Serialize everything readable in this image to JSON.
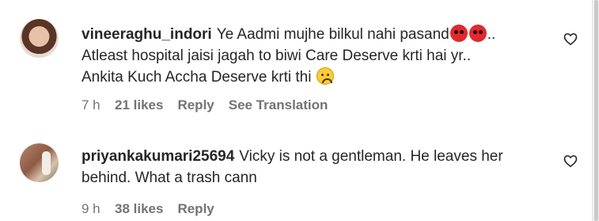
{
  "comments": [
    {
      "username": "vineeraghu_indori",
      "text_1": "Ye Aadmi mujhe bilkul nahi pasand",
      "text_2": "..",
      "text_3": "Atleast hospital jaisi jagah to biwi Care Deserve krti hai yr..",
      "text_4": "Ankita Kuch Accha Deserve krti thi",
      "time": "7 h",
      "likes": "21 likes",
      "reply": "Reply",
      "translate": "See Translation",
      "emojis": [
        "angry-face",
        "angry-face",
        "sad-face"
      ]
    },
    {
      "username": "priyankakumari25694",
      "text_1": "Vicky is not a gentleman. He leaves her",
      "text_2": "behind. What a trash cann",
      "time": "9 h",
      "likes": "38 likes",
      "reply": "Reply"
    }
  ],
  "colors": {
    "text": "#262626",
    "meta": "#737373",
    "angry_emoji": "#e0292c",
    "sad_emoji": "#ffcc33"
  }
}
